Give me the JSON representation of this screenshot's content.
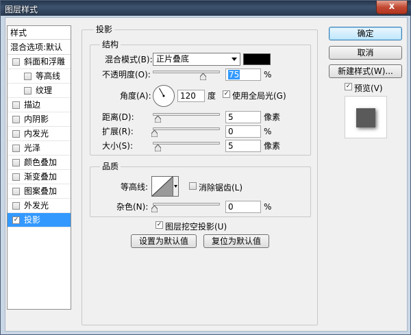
{
  "window": {
    "title": "图层样式",
    "close_glyph": "x"
  },
  "style_list": {
    "header": "样式",
    "blend_options": "混合选项:默认",
    "items": [
      {
        "label": "斜面和浮雕",
        "checked": false,
        "indent": false
      },
      {
        "label": "等高线",
        "checked": false,
        "indent": true
      },
      {
        "label": "纹理",
        "checked": false,
        "indent": true
      },
      {
        "label": "描边",
        "checked": false,
        "indent": false
      },
      {
        "label": "内阴影",
        "checked": false,
        "indent": false
      },
      {
        "label": "内发光",
        "checked": false,
        "indent": false
      },
      {
        "label": "光泽",
        "checked": false,
        "indent": false
      },
      {
        "label": "颜色叠加",
        "checked": false,
        "indent": false
      },
      {
        "label": "渐变叠加",
        "checked": false,
        "indent": false
      },
      {
        "label": "图案叠加",
        "checked": false,
        "indent": false
      },
      {
        "label": "外发光",
        "checked": false,
        "indent": false
      },
      {
        "label": "投影",
        "checked": true,
        "indent": false,
        "selected": true
      }
    ]
  },
  "drop_shadow": {
    "panel_title": "投影",
    "structure": {
      "group_title": "结构",
      "blend_mode_label": "混合模式(B):",
      "blend_mode_value": "正片叠底",
      "blend_color": "#000000",
      "opacity_label": "不透明度(O):",
      "opacity_value": "75",
      "opacity_unit": "%",
      "opacity_fraction": 0.75,
      "angle_label": "角度(A):",
      "angle_value": "120",
      "angle_unit": "度",
      "use_global_light_label": "使用全局光(G)",
      "use_global_light_checked": true,
      "distance_label": "距离(D):",
      "distance_value": "5",
      "distance_unit": "像素",
      "spread_label": "扩展(R):",
      "spread_value": "0",
      "spread_unit": "%",
      "size_label": "大小(S):",
      "size_value": "5",
      "size_unit": "像素"
    },
    "quality": {
      "group_title": "品质",
      "contour_label": "等高线:",
      "anti_alias_label": "消除锯齿(L)",
      "anti_alias_checked": false,
      "noise_label": "杂色(N):",
      "noise_value": "0",
      "noise_unit": "%"
    },
    "knockout_label": "图层挖空投影(U)",
    "knockout_checked": true,
    "make_default_label": "设置为默认值",
    "reset_default_label": "复位为默认值"
  },
  "side_buttons": {
    "ok": "确定",
    "cancel": "取消",
    "new_style": "新建样式(W)...",
    "preview_label": "预览(V)",
    "preview_checked": true
  }
}
